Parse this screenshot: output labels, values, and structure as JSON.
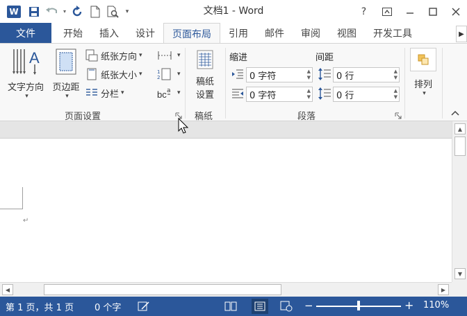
{
  "app": {
    "logo_letter": "W",
    "window_title": "文档1 - Word",
    "help_label": "?"
  },
  "tabs": {
    "file": "文件",
    "items": [
      "开始",
      "插入",
      "设计",
      "页面布局",
      "引用",
      "邮件",
      "审阅",
      "视图",
      "开发工具"
    ],
    "active_index": 3
  },
  "ribbon": {
    "page_setup": {
      "text_direction": "文字方向",
      "margins": "页边距",
      "orientation": "纸张方向",
      "size": "纸张大小",
      "columns": "分栏",
      "label": "页面设置"
    },
    "manuscript": {
      "settings_line1": "稿纸",
      "settings_line2": "设置",
      "label": "稿纸"
    },
    "paragraph": {
      "indent_title": "缩进",
      "spacing_title": "间距",
      "indent_left": "0 字符",
      "indent_right": "0 字符",
      "spacing_before": "0 行",
      "spacing_after": "0 行",
      "label": "段落"
    },
    "arrange": {
      "label": "排列"
    }
  },
  "document": {
    "para_mark": "↵"
  },
  "status": {
    "page": "第 1 页，共 1 页",
    "words": "0 个字",
    "zoom_minus": "−",
    "zoom_plus": "+",
    "zoom_level": "110%",
    "zoom_fraction": 0.5
  },
  "colors": {
    "accent": "#2b579a"
  }
}
